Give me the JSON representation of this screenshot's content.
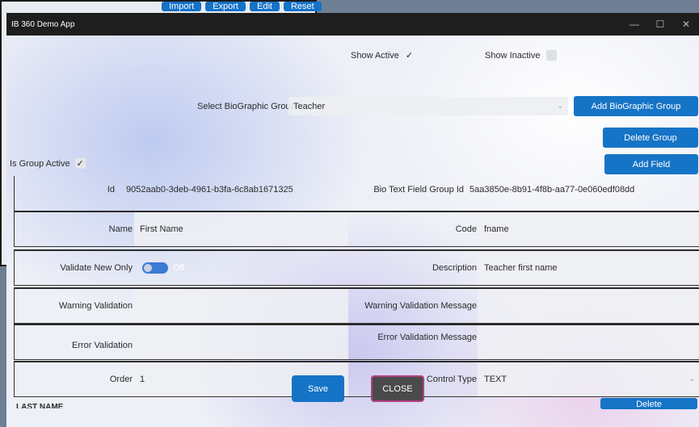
{
  "background_window": {
    "buttons": [
      "Import",
      "Export",
      "Edit",
      "Reset"
    ]
  },
  "window": {
    "title": "IB 360 Demo App",
    "controls": {
      "minimize": "—",
      "maximize": "☐",
      "close": "✕"
    }
  },
  "filters": {
    "show_active_label": "Show Active",
    "show_active_checked": true,
    "show_inactive_label": "Show Inactive",
    "show_inactive_checked": false
  },
  "group": {
    "select_label": "Select BioGraphic Group:",
    "selected_value": "Teacher",
    "add_group_button": "Add BioGraphic Group",
    "delete_group_button": "Delete Group",
    "add_field_button": "Add Field",
    "is_active_label": "Is Group Active",
    "is_active_checked": true
  },
  "field": {
    "id_label": "Id",
    "id_value": "9052aab0-3deb-4961-b3fa-6c8ab1671325",
    "group_id_label": "Bio Text Field Group Id",
    "group_id_value": "5aa3850e-8b91-4f8b-aa77-0e060edf08dd",
    "name_label": "Name",
    "name_value": "First Name",
    "code_label": "Code",
    "code_value": "fname",
    "validate_label": "Validate New Only",
    "validate_state": "Off",
    "description_label": "Description",
    "description_value": "Teacher first name",
    "warning_validation_label": "Warning Validation",
    "warning_validation_value": "",
    "warning_message_label": "Warning Validation Message",
    "warning_message_value": "",
    "error_validation_label": "Error Validation",
    "error_validation_value": "",
    "error_message_label": "Error Validation Message",
    "error_message_value": "",
    "order_label": "Order",
    "order_value": "1",
    "control_type_label": "Control Type",
    "control_type_value": "TEXT"
  },
  "next_section": {
    "heading": "LAST NAME",
    "button": "Delete"
  },
  "footer": {
    "save_button": "Save",
    "close_button": "CLOSE"
  },
  "colors": {
    "accent": "#1674c6",
    "titlebar": "#1e1e1e",
    "close_button": "#4a4a4a"
  }
}
